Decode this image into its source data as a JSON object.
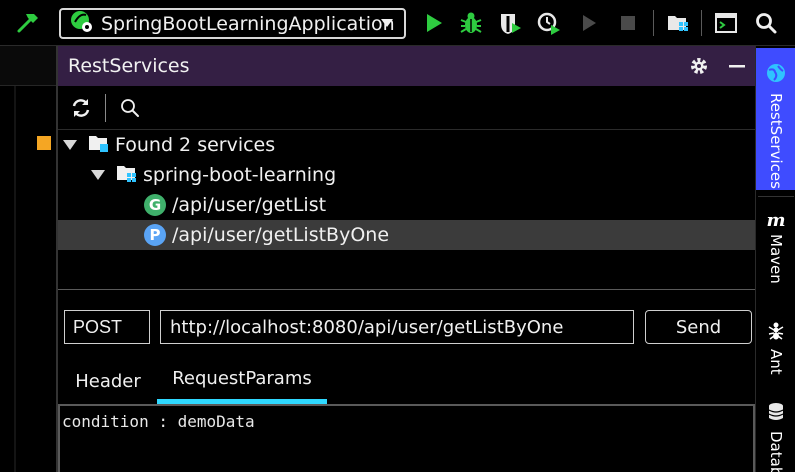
{
  "toolbar": {
    "run_config": "SpringBootLearningApplication",
    "icons": [
      "build-hammer-icon",
      "spring-boot-icon",
      "chevron-down-icon",
      "run-icon",
      "debug-icon",
      "coverage-icon",
      "profile-icon",
      "attach-icon",
      "stop-icon",
      "project-structure-icon",
      "terminal-window-icon",
      "search-icon"
    ],
    "colors": {
      "accent_green": "#2ecc40"
    }
  },
  "tool_window": {
    "title": "RestServices",
    "header_icons": [
      "gear-icon",
      "minimize-icon"
    ],
    "header_bg": "#341f44",
    "actions": [
      "refresh-icon",
      "search-icon"
    ]
  },
  "tree": {
    "root_label": "Found 2 services",
    "module_label": "spring-boot-learning",
    "items": [
      {
        "badge": "G",
        "path": "/api/user/getList",
        "color": "#3fb06b"
      },
      {
        "badge": "P",
        "path": "/api/user/getListByOne",
        "color": "#5aa4f5"
      }
    ],
    "selected_index": 1
  },
  "request": {
    "method": "POST",
    "url": "http://localhost:8080/api/user/getListByOne",
    "send_label": "Send"
  },
  "tabs": [
    {
      "label": "Header"
    },
    {
      "label": "RequestParams"
    }
  ],
  "active_tab": "RequestParams",
  "params_text": "condition : demoData",
  "right_strip": {
    "items": [
      {
        "label": "RestServices",
        "icon": "globe-icon"
      },
      {
        "label": "Maven",
        "icon": "maven-icon"
      },
      {
        "label": "Ant",
        "icon": "ant-icon"
      },
      {
        "label": "Datab",
        "icon": "database-icon"
      }
    ],
    "active_color": "#3f4cff"
  }
}
